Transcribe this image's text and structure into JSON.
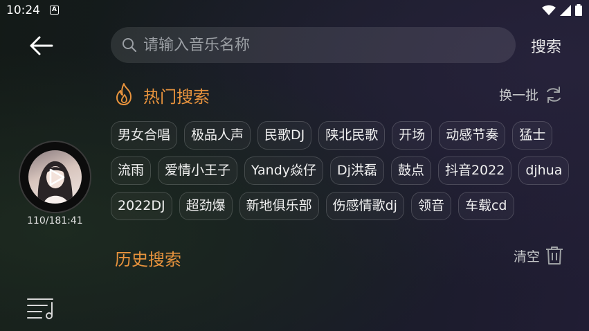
{
  "status_bar": {
    "time": "10:24",
    "notification_letter": "A"
  },
  "search": {
    "placeholder": "请输入音乐名称",
    "value": "",
    "submit_label": "搜索"
  },
  "hot_search": {
    "title": "热门搜索",
    "refresh_label": "换一批",
    "rows": [
      [
        "男女合唱",
        "极品人声",
        "民歌DJ",
        "陕北民歌",
        "开场",
        "动感节奏",
        "猛士"
      ],
      [
        "流雨",
        "爱情小王子",
        "Yandy焱仔",
        "Dj洪磊",
        "鼓点",
        "抖音2022",
        "djhua"
      ],
      [
        "2022DJ",
        "超劲爆",
        "新地俱乐部",
        "伤感情歌dj",
        "领音",
        "车载cd"
      ]
    ]
  },
  "history": {
    "title": "历史搜索",
    "clear_label": "清空"
  },
  "player": {
    "progress": "110/181:41"
  },
  "colors": {
    "accent": "#e8933d",
    "text": "#ffffff",
    "muted": "#c4c6c8"
  }
}
